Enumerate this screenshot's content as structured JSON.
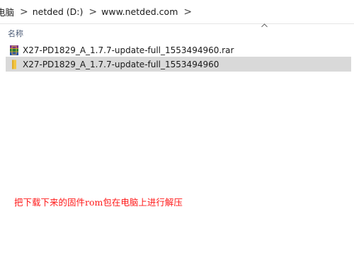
{
  "breadcrumb": {
    "items": [
      "电脑",
      "netded (D:)",
      "www.netded.com"
    ],
    "separator": ">"
  },
  "file_list": {
    "column_header": "名称",
    "sort_icon": "chevron-up-icon",
    "files": [
      {
        "name": "X27-PD1829_A_1.7.7-update-full_1553494960.rar",
        "icon": "winrar-archive-icon",
        "selected": false
      },
      {
        "name": "X27-PD1829_A_1.7.7-update-full_1553494960",
        "icon": "folder-icon",
        "selected": true
      }
    ]
  },
  "annotation": {
    "text": "把下载下来的固件rom包在电脑上进行解压",
    "color": "#ff1a1a"
  },
  "colors": {
    "selected_row": "#d9d9d9",
    "folder": "#f3c644",
    "header_text": "#4a5a75"
  }
}
